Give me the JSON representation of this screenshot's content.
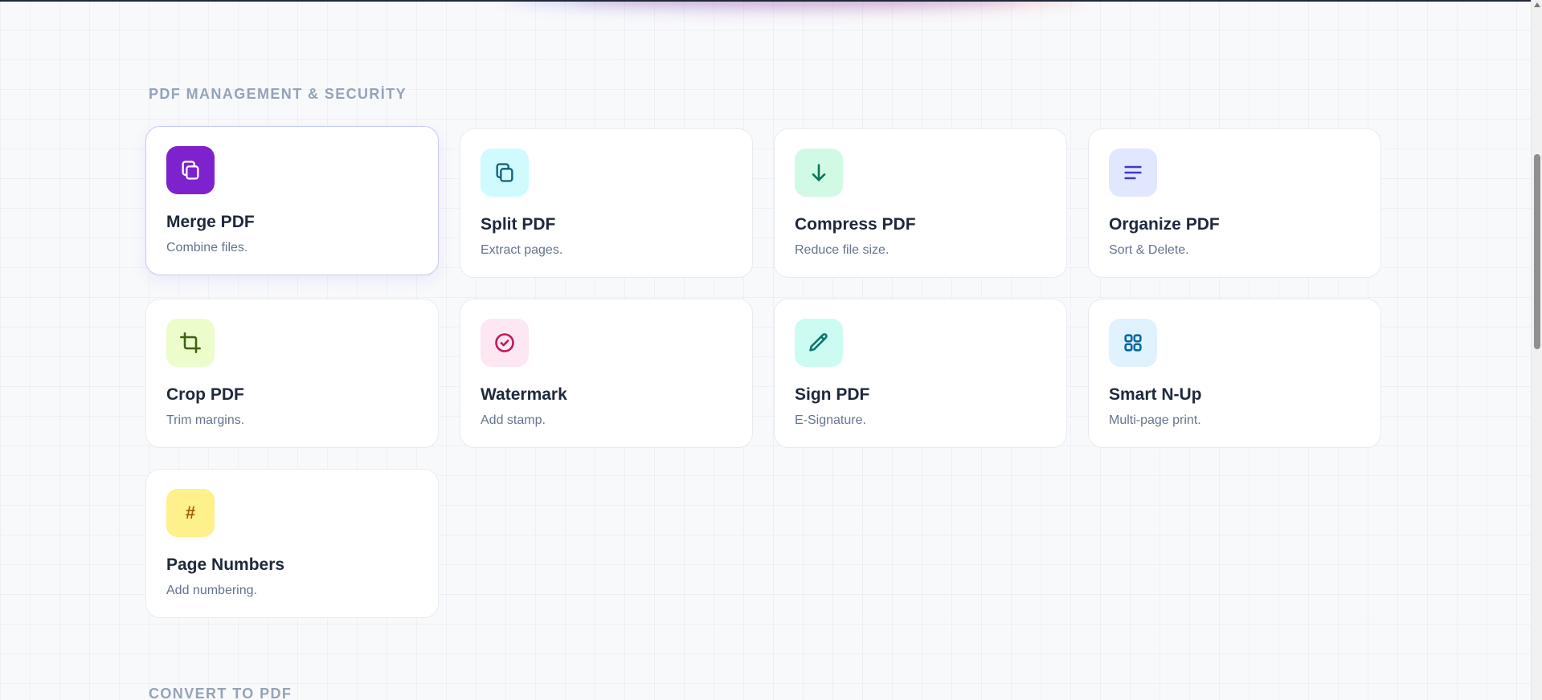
{
  "sections": [
    {
      "title": "PDF MANAGEMENT & SECURİTY",
      "tools": [
        {
          "name": "Merge PDF",
          "desc": "Combine files.",
          "icon": "copy-icon",
          "icon_bg": "#7e22ce",
          "icon_color": "#ffffff",
          "active": true
        },
        {
          "name": "Split PDF",
          "desc": "Extract pages.",
          "icon": "copy-icon",
          "icon_bg": "#cffafe",
          "icon_color": "#155e75"
        },
        {
          "name": "Compress PDF",
          "desc": "Reduce file size.",
          "icon": "arrow-down-icon",
          "icon_bg": "#d1fae5",
          "icon_color": "#047857"
        },
        {
          "name": "Organize PDF",
          "desc": "Sort & Delete.",
          "icon": "menu-lines-icon",
          "icon_bg": "#e0e7ff",
          "icon_color": "#4338ca"
        },
        {
          "name": "Crop PDF",
          "desc": "Trim margins.",
          "icon": "crop-icon",
          "icon_bg": "#ecfccb",
          "icon_color": "#3f6212"
        },
        {
          "name": "Watermark",
          "desc": "Add stamp.",
          "icon": "check-circle-icon",
          "icon_bg": "#fce7f3",
          "icon_color": "#be185d"
        },
        {
          "name": "Sign PDF",
          "desc": "E-Signature.",
          "icon": "pencil-icon",
          "icon_bg": "#ccfbf1",
          "icon_color": "#0f766e"
        },
        {
          "name": "Smart N-Up",
          "desc": "Multi-page print.",
          "icon": "grid-icon",
          "icon_bg": "#e0f2fe",
          "icon_color": "#0369a1"
        },
        {
          "name": "Page Numbers",
          "desc": "Add numbering.",
          "icon": "hash-icon",
          "icon_bg": "#fef08a",
          "icon_color": "#a16207"
        }
      ]
    },
    {
      "title": "CONVERT TO PDF"
    }
  ]
}
